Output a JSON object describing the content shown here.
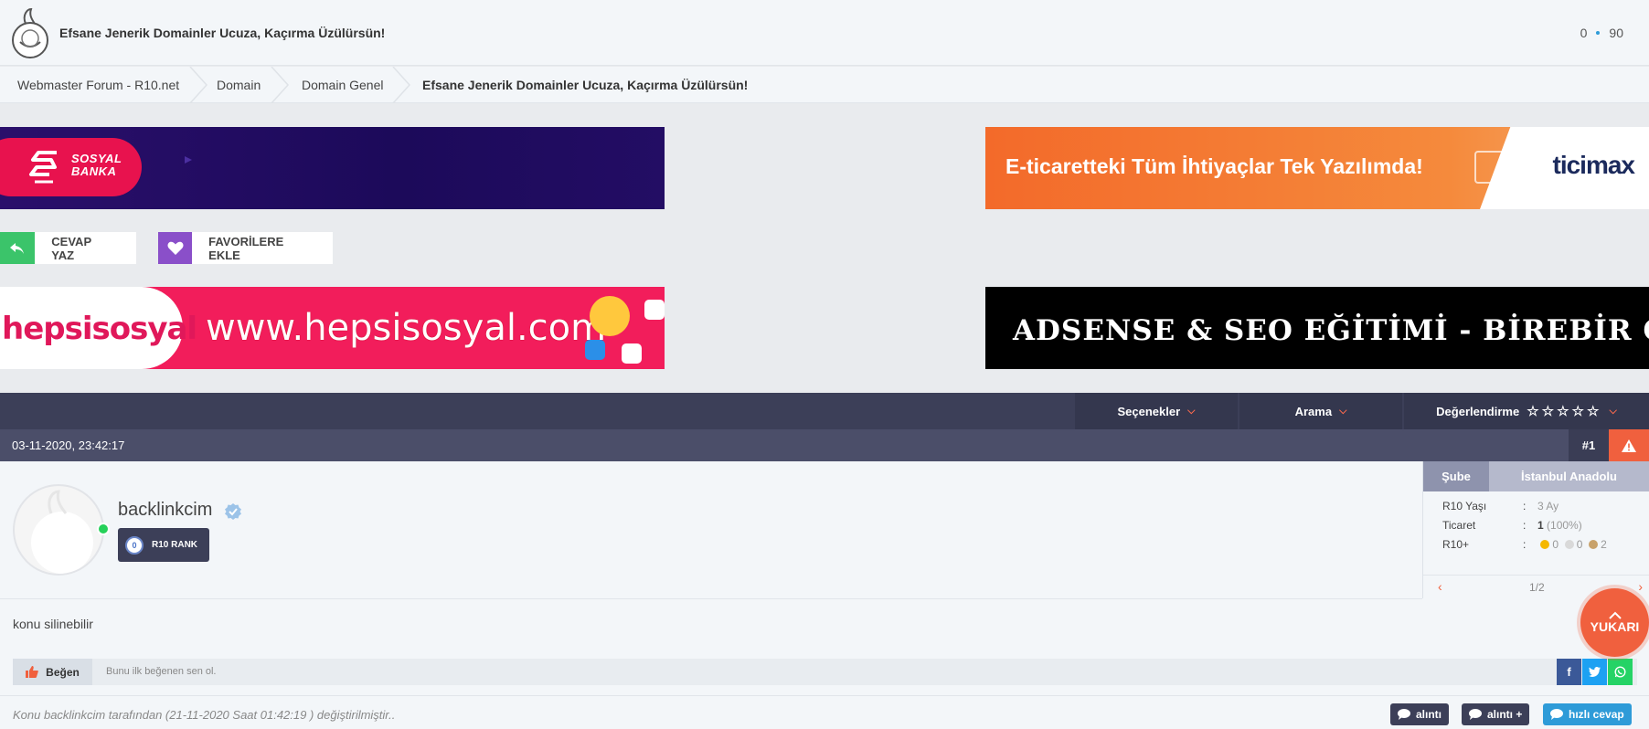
{
  "header": {
    "site_title": "Efsane Jenerik Domainler Ucuza, Kaçırma Üzülürsün!",
    "stat_left": "0",
    "stat_right": "90"
  },
  "breadcrumb": {
    "items": [
      "Webmaster Forum - R10.net",
      "Domain",
      "Domain Genel",
      "Efsane Jenerik Domainler Ucuza, Kaçırma Üzülürsün!"
    ]
  },
  "banners": {
    "sosyal_banka": {
      "line1": "SOSYAL",
      "line2": "BANKA"
    },
    "ticimax": {
      "slogan": "E-ticaretteki Tüm İhtiyaçlar Tek Yazılımda!",
      "brand": "ticimax"
    },
    "hepsisosyal": {
      "logo": "hepsisosyal",
      "url": "www.hepsisosyal.com"
    },
    "adsense": {
      "text": "ADSENSE & SEO EĞİTİMİ - BİREBİR ONLİNE!"
    }
  },
  "actions": {
    "reply_label": "CEVAP YAZ",
    "fav_label": "FAVORİLERE EKLE"
  },
  "options_bar": {
    "options": "Seçenekler",
    "search": "Arama",
    "rating": "Değerlendirme",
    "stars": "☆☆☆☆☆"
  },
  "post": {
    "date": "03-11-2020, 23:42:17",
    "number": "#1",
    "username": "backlinkcim",
    "rank_level": "0",
    "rank_label": "R10 RANK",
    "info": {
      "tab_branch": "Şube",
      "tab_location": "İstanbul Anadolu",
      "age_label": "R10 Yaşı",
      "age_value": "3 Ay",
      "trade_label": "Ticaret",
      "trade_value": "1",
      "trade_pct": "(100%)",
      "plus_label": "R10+",
      "gold": "0",
      "silver": "0",
      "bronze": "2",
      "colon": ":",
      "page": "1/2",
      "coin_colors": {
        "gold": "#f5b800",
        "silver": "#d9d9d9",
        "bronze": "#c8a26b"
      }
    },
    "content": "konu silinebilir",
    "like_label": "Beğen",
    "like_text": "Bunu ilk beğenen sen ol.",
    "mod_note": "Konu backlinkcim tarafından (21-11-2020 Saat 01:42:19 ) değiştirilmiştir..",
    "quote_label": "alıntı",
    "multi_quote_label": "alıntı +",
    "quick_reply_label": "hızlı cevap"
  },
  "to_top": {
    "label": "YUKARI"
  },
  "colors": {
    "accent": "#f0603e",
    "navbar": "#3c3f58",
    "reply_green": "#3bc46a",
    "fav_purple": "#8a4fc9",
    "facebook": "#3b5998",
    "twitter": "#1da1f2",
    "whatsapp": "#25d366",
    "quick_reply": "#2e9bd8"
  }
}
